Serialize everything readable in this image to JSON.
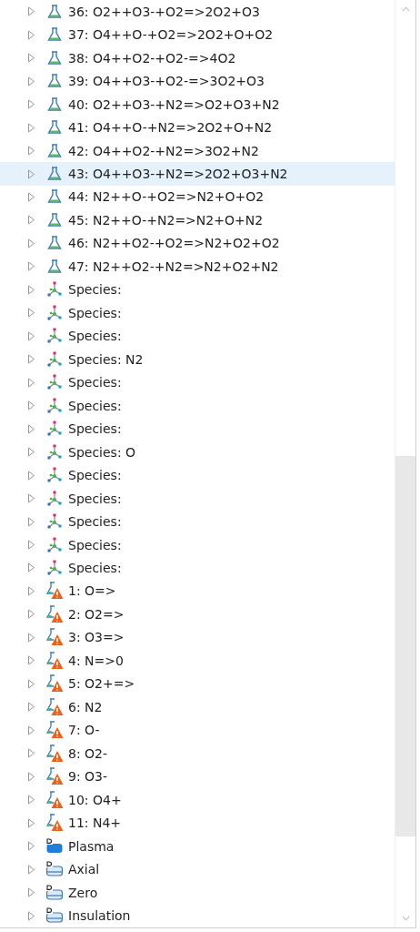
{
  "tree": {
    "items": [
      {
        "kind": "reaction",
        "label": "36: O2++O3-+O2=>2O2+O3",
        "selected": false,
        "expanded": false
      },
      {
        "kind": "reaction",
        "label": "37: O4++O-+O2=>2O2+O+O2",
        "selected": false,
        "expanded": false
      },
      {
        "kind": "reaction",
        "label": "38: O4++O2-+O2-=>4O2",
        "selected": false,
        "expanded": false
      },
      {
        "kind": "reaction",
        "label": "39: O4++O3-+O2-=>3O2+O3",
        "selected": false,
        "expanded": false
      },
      {
        "kind": "reaction",
        "label": "40: O2++O3-+N2=>O2+O3+N2",
        "selected": false,
        "expanded": false
      },
      {
        "kind": "reaction",
        "label": "41: O4++O-+N2=>2O2+O+N2",
        "selected": false,
        "expanded": false
      },
      {
        "kind": "reaction",
        "label": "42: O4++O2-+N2=>3O2+N2",
        "selected": false,
        "expanded": false
      },
      {
        "kind": "reaction",
        "label": "43: O4++O3-+N2=>2O2+O3+N2",
        "selected": true,
        "expanded": false
      },
      {
        "kind": "reaction",
        "label": "44: N2++O-+O2=>N2+O+O2",
        "selected": false,
        "expanded": false
      },
      {
        "kind": "reaction",
        "label": "45: N2++O-+N2=>N2+O+N2",
        "selected": false,
        "expanded": false
      },
      {
        "kind": "reaction",
        "label": "46: N2++O2-+O2=>N2+O2+O2",
        "selected": false,
        "expanded": false
      },
      {
        "kind": "reaction",
        "label": "47: N2++O2-+N2=>N2+O2+N2",
        "selected": false,
        "expanded": false
      },
      {
        "kind": "species",
        "label": "Species:",
        "selected": false,
        "expanded": false
      },
      {
        "kind": "species",
        "label": "Species:",
        "selected": false,
        "expanded": false
      },
      {
        "kind": "species",
        "label": "Species:",
        "selected": false,
        "expanded": false
      },
      {
        "kind": "species",
        "label": "Species: N2",
        "selected": false,
        "expanded": false
      },
      {
        "kind": "species",
        "label": "Species:",
        "selected": false,
        "expanded": false
      },
      {
        "kind": "species",
        "label": "Species:",
        "selected": false,
        "expanded": false
      },
      {
        "kind": "species",
        "label": "Species:",
        "selected": false,
        "expanded": false
      },
      {
        "kind": "species",
        "label": "Species: O",
        "selected": false,
        "expanded": false
      },
      {
        "kind": "species",
        "label": "Species:",
        "selected": false,
        "expanded": false
      },
      {
        "kind": "species",
        "label": "Species:",
        "selected": false,
        "expanded": false
      },
      {
        "kind": "species",
        "label": "Species:",
        "selected": false,
        "expanded": false
      },
      {
        "kind": "species",
        "label": "Species:",
        "selected": false,
        "expanded": false
      },
      {
        "kind": "species",
        "label": "Species:",
        "selected": false,
        "expanded": false
      },
      {
        "kind": "reaction-warning",
        "label": "1: O=>",
        "selected": false,
        "expanded": false
      },
      {
        "kind": "reaction-warning",
        "label": "2: O2=>",
        "selected": false,
        "expanded": false
      },
      {
        "kind": "reaction-warning",
        "label": "3: O3=>",
        "selected": false,
        "expanded": false
      },
      {
        "kind": "reaction-warning",
        "label": "4: N=>0",
        "selected": false,
        "expanded": false
      },
      {
        "kind": "reaction-warning",
        "label": "5: O2+=>",
        "selected": false,
        "expanded": false
      },
      {
        "kind": "reaction-warning",
        "label": "6: N2",
        "selected": false,
        "expanded": false
      },
      {
        "kind": "reaction-warning",
        "label": "7: O-",
        "selected": false,
        "expanded": false
      },
      {
        "kind": "reaction-warning",
        "label": "8: O2-",
        "selected": false,
        "expanded": false
      },
      {
        "kind": "reaction-warning",
        "label": "9: O3-",
        "selected": false,
        "expanded": false
      },
      {
        "kind": "reaction-warning",
        "label": "10: O4+",
        "selected": false,
        "expanded": false
      },
      {
        "kind": "reaction-warning",
        "label": "11: N4+",
        "selected": false,
        "expanded": false
      },
      {
        "kind": "domain-filled",
        "label": "Plasma",
        "selected": false,
        "expanded": false
      },
      {
        "kind": "domain",
        "label": "Axial",
        "selected": false,
        "expanded": false
      },
      {
        "kind": "domain",
        "label": "Zero",
        "selected": false,
        "expanded": false
      },
      {
        "kind": "domain",
        "label": "Insulation",
        "selected": false,
        "expanded": false
      }
    ]
  }
}
